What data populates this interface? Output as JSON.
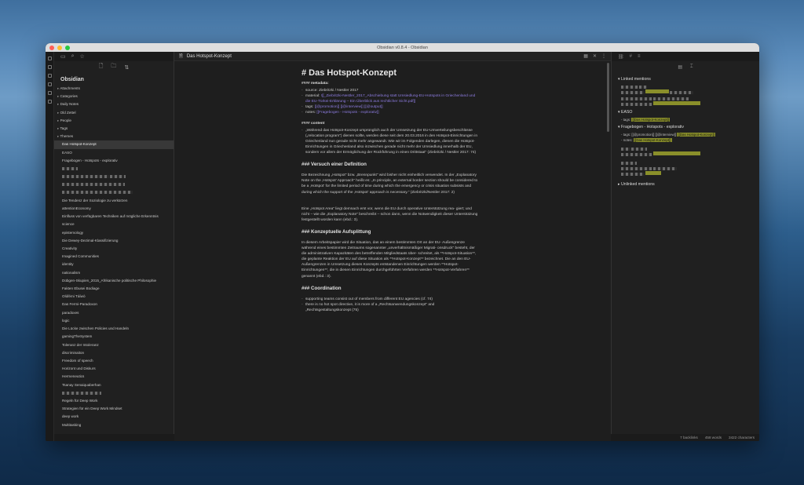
{
  "app": {
    "title": "Obsidian v0.8.4 - Obsidian"
  },
  "sidebar": {
    "vault": "Obsidian",
    "folders": [
      "Attachments",
      "Categories",
      "Daily Notes",
      "Old Zettel",
      "People",
      "Tags",
      "Themes"
    ],
    "active": "Das Hotspot-Konzept",
    "files_top": [
      "EASO",
      "Fragebogen - Hotspots - explorativ"
    ],
    "files": [
      "Die Tendenz der Soziologie zu verkürzen",
      "attentionEconomy",
      "Einfluss von verfügbaren Techniken auf mögliche Erkenntnis",
      "science",
      "epistemology",
      "Die Dewey-Dezimal-Klassifizierung",
      "Creativity",
      "Imagined Communities",
      "identity",
      "nationalism",
      "Dübgen-Skupien_2015_Afrikanische politische Philosophie",
      "Fakten Ebusei Bodiage",
      "Olúfémi Táíwò",
      "Das Fermi-Paradoxon",
      "paradoxes",
      "logic",
      "Die Lücke zwischen Policies und Handeln",
      "gamingTheSystem",
      "Toleranz der Intoleranz",
      "discriminaiton",
      "Freedom of speech",
      "Horizont und Diskurs",
      "Hermeneutics",
      "Tsanay Senaiquaberhan"
    ],
    "files_bottom": [
      "Regeln für Deep Work",
      "Strategien für ein Deep Work Mindset",
      "deep work",
      "Multitasking"
    ]
  },
  "editor": {
    "tab": "Das Hotspot-Konzept",
    "h1": "# Das Hotspot-Konzept",
    "meta_h": "#### metadata:",
    "meta": [
      {
        "k": "source: ",
        "v": "Ziebritzki / Nestler 2017"
      },
      {
        "k": "material: ",
        "v": "![[_Ziebritzki-Nestler_2017_Abschiebung statt Umsiedlung-EU-Hotspots in Griechenland und die EU-Türkei-Erklärung – Ein Überblick aus rechtlicher Sicht.pdf]]"
      },
      {
        "k": "tags: ",
        "v": "[[@promotion]] [[@interview]] [[@output]]"
      },
      {
        "k": "notes: ",
        "v": "[[Fragebogen - Hotspots - explorativ]]"
      }
    ],
    "content_h": "#### content",
    "content": "„Während das Hotspot-Konzept ursprünglich auch der Umsetzung der EU-Umverteilungsbeschlüsse („relocation program\") dienen sollte, werden diese seit dem 20.03.2016 in den Hotspot-Einrichtungen in Griechenland nun gerade nicht mehr angewandt. Wie wir im Folgenden darlegen, dienen die Hotspot-Einrichtungen in Griechenland also inzwischen gerade nicht mehr der Umsiedlung innerhalb der EU, sondern vor allem der Ermöglichung der Rückführung in einen Drittstaat\" (Ziebritzki / Nestler 2017: 74)",
    "h3a": "### Versuch einer Definition",
    "p1": "Die Bezeichnung „Hotspot\" bzw. „Brennpunkt\" wird bisher nicht einheitlich verwendet. In der „Explanatory Note on the ‚Hotspot' Approach\" heißt es: „In principle, an external border section should be considered to be a ‚Hotspot' for the limited period of time during which the emergency or crisis situation subsists and during which the support of the ‚Hotspot' approach is necessary.\" (Ziebritzki/Nestler 2017: 2)",
    "p2": "Eine „Hotspot Area\" liegt demnach erst vor, wenn die EU durch operative Unterstützung rea- giert; und nicht – wie die „Explanatory Note\" beschreibt – schon dann, wenn die Notwendigkeit dieser Unterstützung festgestellt worden kann (ebd.: 3).",
    "h3b": "### Konzeptuelle Aufsplittung",
    "p3": "In diesem Arbeitspapier wird die Situation, das an einem bestimmten Ort an der EU- Außengrenze während eines bestimmten Zeitraums sogenannter „unverhältnismäßiger Migrati- onsdruck\" besteht, der die administrativen Kapazitäten des betreffenden Mitgliedstaats über- schreitet, als **Hotspot-Situation**, die geplante Reaktion der EU auf diese Situation als **Hotspot-Konzept** bezeichnet. Die an den EU-Außengrenzen in Umsetzung dieses Konzepts entstandenen Einrichtungen werden **Hotspot-Einrichtungen**, die in diesen Einrichtungen durchgeführten Verfahren werden **Hotspot-Verfahren** genannt (ebd.: 3).",
    "h3c": "### Coordination",
    "b1": "supporting teams consist out of members from different EU agencies (cf. 74)",
    "b2": "there is no hot spot directive, it is more of a „Rechtsanwendungskonzept\" and „Rechtsgestaltungskonzept (75)"
  },
  "right": {
    "linked": "Linked mentions",
    "easo": "EASO",
    "easo_tags": "tags: ",
    "easo_hl": "[[Das Hotspot-Konzept]]",
    "frage": "Fragebogen - Hotspots - explorativ",
    "frage_tags": "tags: [[@promotion]] [[@interview]] ",
    "frage_notes": "notes: ",
    "unlinked": "Unlinked mentions"
  },
  "status": {
    "backlinks": "7 backlinks",
    "words": "458 words",
    "chars": "3422 characters"
  }
}
